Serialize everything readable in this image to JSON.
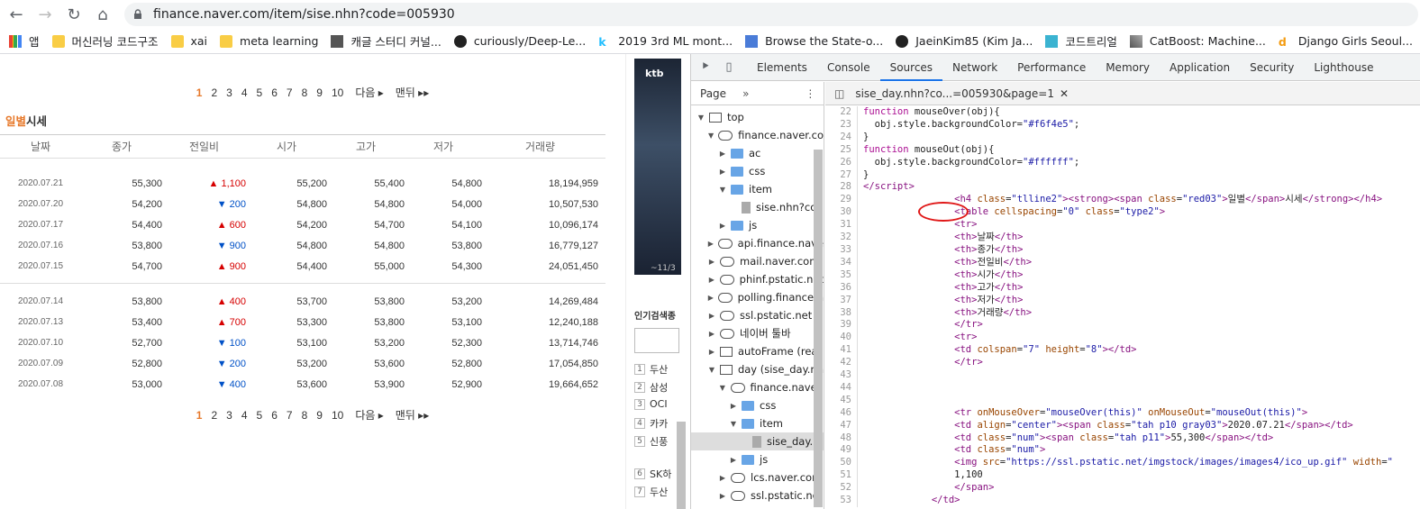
{
  "browser": {
    "url": "finance.naver.com/item/sise.nhn?code=005930",
    "bookmarks": [
      "앱",
      "머신러닝 코드구조",
      "xai",
      "meta learning",
      "캐글 스터디 커널...",
      "curiously/Deep-Le...",
      "2019 3rd ML mont...",
      "Browse the State-o...",
      "JaeinKim85 (Kim Ja...",
      "코드트리얼",
      "CatBoost: Machine...",
      "Django Girls Seoul..."
    ]
  },
  "page": {
    "pager": {
      "pages": [
        "1",
        "2",
        "3",
        "4",
        "5",
        "6",
        "7",
        "8",
        "9",
        "10"
      ],
      "next": "다음",
      "last": "맨뒤"
    },
    "section_title_red": "일별",
    "section_title_rest": "시세",
    "headers": [
      "날짜",
      "종가",
      "전일비",
      "시가",
      "고가",
      "저가",
      "거래량"
    ],
    "rows_group1": [
      {
        "date": "2020.07.21",
        "close": "55,300",
        "dir": "up",
        "change": "1,100",
        "open": "55,200",
        "high": "55,400",
        "low": "54,800",
        "volume": "18,194,959"
      },
      {
        "date": "2020.07.20",
        "close": "54,200",
        "dir": "down",
        "change": "200",
        "open": "54,800",
        "high": "54,800",
        "low": "54,000",
        "volume": "10,507,530"
      },
      {
        "date": "2020.07.17",
        "close": "54,400",
        "dir": "up",
        "change": "600",
        "open": "54,200",
        "high": "54,700",
        "low": "54,100",
        "volume": "10,096,174"
      },
      {
        "date": "2020.07.16",
        "close": "53,800",
        "dir": "down",
        "change": "900",
        "open": "54,800",
        "high": "54,800",
        "low": "53,800",
        "volume": "16,779,127"
      },
      {
        "date": "2020.07.15",
        "close": "54,700",
        "dir": "up",
        "change": "900",
        "open": "54,400",
        "high": "55,000",
        "low": "54,300",
        "volume": "24,051,450"
      }
    ],
    "rows_group2": [
      {
        "date": "2020.07.14",
        "close": "53,800",
        "dir": "up",
        "change": "400",
        "open": "53,700",
        "high": "53,800",
        "low": "53,200",
        "volume": "14,269,484"
      },
      {
        "date": "2020.07.13",
        "close": "53,400",
        "dir": "up",
        "change": "700",
        "open": "53,300",
        "high": "53,800",
        "low": "53,100",
        "volume": "12,240,188"
      },
      {
        "date": "2020.07.10",
        "close": "52,700",
        "dir": "down",
        "change": "100",
        "open": "53,100",
        "high": "53,200",
        "low": "52,300",
        "volume": "13,714,746"
      },
      {
        "date": "2020.07.09",
        "close": "52,800",
        "dir": "down",
        "change": "200",
        "open": "53,200",
        "high": "53,600",
        "low": "52,800",
        "volume": "17,054,850"
      },
      {
        "date": "2020.07.08",
        "close": "53,000",
        "dir": "down",
        "change": "400",
        "open": "53,600",
        "high": "53,900",
        "low": "52,900",
        "volume": "19,664,652"
      }
    ]
  },
  "ad": {
    "logo": "ktb",
    "caption": "~11/3",
    "popular_title": "인기검색종",
    "popular": [
      {
        "n": "1",
        "t": "두산"
      },
      {
        "n": "2",
        "t": "삼성"
      },
      {
        "n": "3",
        "t": "OCI"
      },
      {
        "n": "4",
        "t": "카카"
      },
      {
        "n": "5",
        "t": "신풍"
      },
      {
        "n": "6",
        "t": "SK하"
      },
      {
        "n": "7",
        "t": "두산"
      }
    ]
  },
  "devtools": {
    "tabs": [
      "Elements",
      "Console",
      "Sources",
      "Network",
      "Performance",
      "Memory",
      "Application",
      "Security",
      "Lighthouse"
    ],
    "active_tab": "Sources",
    "left_panel_tab": "Page",
    "editor_tab": "sise_day.nhn?co...=005930&page=1",
    "tree": [
      {
        "indent": 0,
        "arrow": "▼",
        "icon": "frame",
        "label": "top"
      },
      {
        "indent": 1,
        "arrow": "▼",
        "icon": "cloud",
        "label": "finance.naver.co"
      },
      {
        "indent": 2,
        "arrow": "▶",
        "icon": "folder",
        "label": "ac"
      },
      {
        "indent": 2,
        "arrow": "▶",
        "icon": "folder",
        "label": "css"
      },
      {
        "indent": 2,
        "arrow": "▼",
        "icon": "folder",
        "label": "item"
      },
      {
        "indent": 3,
        "arrow": "",
        "icon": "file",
        "label": "sise.nhn?co"
      },
      {
        "indent": 2,
        "arrow": "▶",
        "icon": "folder",
        "label": "js"
      },
      {
        "indent": 1,
        "arrow": "▶",
        "icon": "cloud",
        "label": "api.finance.nave"
      },
      {
        "indent": 1,
        "arrow": "▶",
        "icon": "cloud",
        "label": "mail.naver.com"
      },
      {
        "indent": 1,
        "arrow": "▶",
        "icon": "cloud",
        "label": "phinf.pstatic.net"
      },
      {
        "indent": 1,
        "arrow": "▶",
        "icon": "cloud",
        "label": "polling.finance.n"
      },
      {
        "indent": 1,
        "arrow": "▶",
        "icon": "cloud",
        "label": "ssl.pstatic.net"
      },
      {
        "indent": 1,
        "arrow": "▶",
        "icon": "cloud",
        "label": "네이버 툴바"
      },
      {
        "indent": 1,
        "arrow": "▶",
        "icon": "frame",
        "label": "autoFrame (reat"
      },
      {
        "indent": 1,
        "arrow": "▼",
        "icon": "frame",
        "label": "day (sise_day.nh"
      },
      {
        "indent": 2,
        "arrow": "▼",
        "icon": "cloud",
        "label": "finance.naver."
      },
      {
        "indent": 3,
        "arrow": "▶",
        "icon": "folder",
        "label": "css"
      },
      {
        "indent": 3,
        "arrow": "▼",
        "icon": "folder",
        "label": "item"
      },
      {
        "indent": 4,
        "arrow": "",
        "icon": "file",
        "label": "sise_day.",
        "selected": true
      },
      {
        "indent": 3,
        "arrow": "▶",
        "icon": "folder",
        "label": "js"
      },
      {
        "indent": 2,
        "arrow": "▶",
        "icon": "cloud",
        "label": "lcs.naver.com"
      },
      {
        "indent": 2,
        "arrow": "▶",
        "icon": "cloud",
        "label": "ssl.pstatic.net"
      }
    ],
    "code_lines": [
      {
        "n": "22",
        "html": "<span class=\"kw\">function</span> mouseOver(obj){"
      },
      {
        "n": "23",
        "html": "  obj.style.backgroundColor=<span class=\"av\">\"#f6f4e5\"</span>;"
      },
      {
        "n": "24",
        "html": "}"
      },
      {
        "n": "25",
        "html": "<span class=\"kw\">function</span> mouseOut(obj){"
      },
      {
        "n": "26",
        "html": "  obj.style.backgroundColor=<span class=\"av\">\"#ffffff\"</span>;"
      },
      {
        "n": "27",
        "html": "}"
      },
      {
        "n": "28",
        "html": "<span class=\"tg\">&lt;/script&gt;</span>"
      },
      {
        "n": "29",
        "html": "                <span class=\"tg\">&lt;h4</span> <span class=\"at\">class</span>=<span class=\"av\">\"tlline2\"</span><span class=\"tg\">&gt;&lt;strong&gt;&lt;span</span> <span class=\"at\">class</span>=<span class=\"av\">\"red03\"</span><span class=\"tg\">&gt;</span>일별<span class=\"tg\">&lt;/span&gt;</span>시세<span class=\"tg\">&lt;/strong&gt;&lt;/h4&gt;</span>"
      },
      {
        "n": "30",
        "html": "                <span class=\"tg\">&lt;table</span> <span class=\"at\">cellspacing</span>=<span class=\"av\">\"0\"</span> <span class=\"at\">class</span>=<span class=\"av\">\"type2\"</span><span class=\"tg\">&gt;</span>"
      },
      {
        "n": "31",
        "html": "                <span class=\"tg\">&lt;tr&gt;</span>"
      },
      {
        "n": "32",
        "html": "                <span class=\"tg\">&lt;th&gt;</span>날짜<span class=\"tg\">&lt;/th&gt;</span>"
      },
      {
        "n": "33",
        "html": "                <span class=\"tg\">&lt;th&gt;</span>종가<span class=\"tg\">&lt;/th&gt;</span>"
      },
      {
        "n": "34",
        "html": "                <span class=\"tg\">&lt;th&gt;</span>전일비<span class=\"tg\">&lt;/th&gt;</span>"
      },
      {
        "n": "35",
        "html": "                <span class=\"tg\">&lt;th&gt;</span>시가<span class=\"tg\">&lt;/th&gt;</span>"
      },
      {
        "n": "36",
        "html": "                <span class=\"tg\">&lt;th&gt;</span>고가<span class=\"tg\">&lt;/th&gt;</span>"
      },
      {
        "n": "37",
        "html": "                <span class=\"tg\">&lt;th&gt;</span>저가<span class=\"tg\">&lt;/th&gt;</span>"
      },
      {
        "n": "38",
        "html": "                <span class=\"tg\">&lt;th&gt;</span>거래량<span class=\"tg\">&lt;/th&gt;</span>"
      },
      {
        "n": "39",
        "html": "                <span class=\"tg\">&lt;/tr&gt;</span>"
      },
      {
        "n": "40",
        "html": "                <span class=\"tg\">&lt;tr&gt;</span>"
      },
      {
        "n": "41",
        "html": "                <span class=\"tg\">&lt;td</span> <span class=\"at\">colspan</span>=<span class=\"av\">\"7\"</span> <span class=\"at\">height</span>=<span class=\"av\">\"8\"</span><span class=\"tg\">&gt;&lt;/td&gt;</span>"
      },
      {
        "n": "42",
        "html": "                <span class=\"tg\">&lt;/tr&gt;</span>"
      },
      {
        "n": "43",
        "html": ""
      },
      {
        "n": "44",
        "html": ""
      },
      {
        "n": "45",
        "html": ""
      },
      {
        "n": "46",
        "html": "                <span class=\"tg\">&lt;tr</span> <span class=\"at\">onMouseOver</span>=<span class=\"av\">\"mouseOver(this)\"</span> <span class=\"at\">onMouseOut</span>=<span class=\"av\">\"mouseOut(this)\"</span><span class=\"tg\">&gt;</span>"
      },
      {
        "n": "47",
        "html": "                <span class=\"tg\">&lt;td</span> <span class=\"at\">align</span>=<span class=\"av\">\"center\"</span><span class=\"tg\">&gt;&lt;span</span> <span class=\"at\">class</span>=<span class=\"av\">\"tah p10 gray03\"</span><span class=\"tg\">&gt;</span>2020.07.21<span class=\"tg\">&lt;/span&gt;&lt;/td&gt;</span>"
      },
      {
        "n": "48",
        "html": "                <span class=\"tg\">&lt;td</span> <span class=\"at\">class</span>=<span class=\"av\">\"num\"</span><span class=\"tg\">&gt;&lt;span</span> <span class=\"at\">class</span>=<span class=\"av\">\"tah p11\"</span><span class=\"tg\">&gt;</span>55,300<span class=\"tg\">&lt;/span&gt;&lt;/td&gt;</span>"
      },
      {
        "n": "49",
        "html": "                <span class=\"tg\">&lt;td</span> <span class=\"at\">class</span>=<span class=\"av\">\"num\"</span><span class=\"tg\">&gt;</span>"
      },
      {
        "n": "50",
        "html": "                <span class=\"tg\">&lt;img</span> <span class=\"at\">src</span>=<span class=\"av\">\"https://ssl.pstatic.net/imgstock/images/images4/ico_up.gif\"</span> <span class=\"at\">width</span>=<span class=\"av\">\"</span>"
      },
      {
        "n": "51",
        "html": "                1,100"
      },
      {
        "n": "52",
        "html": "                <span class=\"tg\">&lt;/span&gt;</span>"
      },
      {
        "n": "53",
        "html": "            <span class=\"tg\">&lt;/td&gt;</span>"
      }
    ]
  }
}
